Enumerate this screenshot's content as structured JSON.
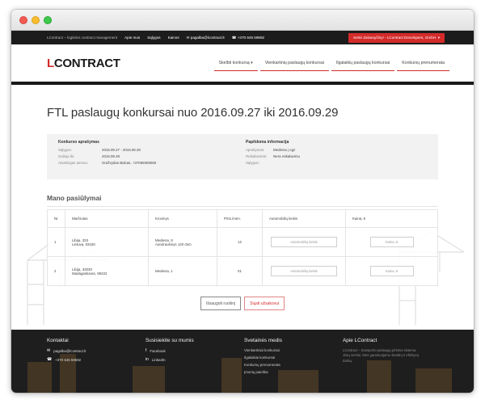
{
  "topbar": {
    "tagline": "LContract – logistics contract management",
    "links": [
      "Apie mus",
      "Sąlygos",
      "Kainos"
    ],
    "email": "pagalba@lcontract.lt",
    "phone": "+370 645 59592",
    "user": "Sertė Zalvanyčiny! - LContract Developers, GmbH."
  },
  "header": {
    "logo_l": "L",
    "logo_rest": "CONTRACT",
    "nav": [
      "Skelbti konkursą ▾",
      "Vienkartinių paslaugų konkursai",
      "Ilgalaikių paslaugų konkursai",
      "Konkursų prenumerata"
    ]
  },
  "page": {
    "title": "FTL paslaugų konkursai nuo 2016.09.27 iki 2016.09.29"
  },
  "info": {
    "left_title": "Konkurso aprašymas",
    "left_rows": [
      {
        "label": "Sąlygos:",
        "value": "2016.09.27 - 2016.09.29"
      },
      {
        "label": "Galioja iki:",
        "value": "2016.09.28"
      },
      {
        "label": "Atsakingas asmuo:",
        "value": "Gražvydas Balcas, +37069305060"
      }
    ],
    "right_title": "Papildoma informacija",
    "right_rows": [
      {
        "label": "Aprašymas:",
        "value": "Mediena į egz"
      },
      {
        "label": "Reikalavimai:",
        "value": "Nera reikalavimu"
      },
      {
        "label": "Sąlygos:",
        "value": ""
      }
    ]
  },
  "offers": {
    "title": "Mano pasiūlymai",
    "headers": [
      "Nr.",
      "Maršrutas",
      "Krovinys",
      "Prist./mėn.",
      "Automobilių kiekis",
      "Kaina, €"
    ],
    "rows": [
      {
        "nr": "1",
        "route_1": "Libija, 333",
        "route_2": "Lietuva, 03150",
        "cargo_1": "Mediena, 9",
        "cargo_2": "Autotraukinys 120 cbm",
        "qty": "12",
        "cars_placeholder": "Automobilių kiekis",
        "price_placeholder": "Kaina, €"
      },
      {
        "nr": "2",
        "route_1": "Libija, 33030",
        "route_2": "Madagaskaras, 99222",
        "cargo_1": "Mediena, 1",
        "cargo_2": "",
        "qty": "01",
        "cars_placeholder": "Automobilių kiekis",
        "price_placeholder": "Kaina, €"
      }
    ],
    "save_label": "Išsaugoti ruošinį",
    "send_label": "Siųsti užsakovui"
  },
  "footer": {
    "contacts_title": "Kontaktai",
    "email": "pagalba@lcontract.lt",
    "phone": "+370 645 59592",
    "social_title": "Susisiekite su mumis",
    "facebook": "Facebook",
    "linkedin": "LinkedIn",
    "sitemap_title": "Svetainės medis",
    "sitemap": [
      "Vienkartiniai konkursai",
      "Ilgalaikiai konkursai",
      "Konkursų prenumerata",
      "Įmonių paieška"
    ],
    "about_title": "Apie LContract",
    "about_text": "LContract – transporto paslaugų pirkimo sistema. Jūsų verslui. Mes garantuojame skaidrų ir efektyvų darbą."
  },
  "colors": {
    "accent": "#d42a2a",
    "dark": "#1c1c1c"
  }
}
